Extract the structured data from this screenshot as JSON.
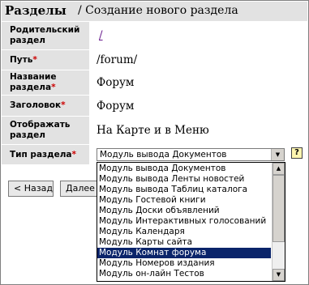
{
  "header": {
    "title_main": "Разделы",
    "title_sub": "/ Создание нового раздела"
  },
  "form": {
    "parent": {
      "label": "Родительский раздел",
      "value": "/"
    },
    "path": {
      "label": "Путь",
      "required_mark": "*",
      "value": "/forum/"
    },
    "name": {
      "label": "Название раздела",
      "required_mark": "*",
      "value": "Форум"
    },
    "heading": {
      "label": "Заголовок",
      "required_mark": "*",
      "value": "Форум"
    },
    "display": {
      "label": "Отображать раздел",
      "value": "На Карте и в Меню"
    },
    "type": {
      "label": "Тип раздела",
      "required_mark": "*",
      "selected": "Модуль вывода Документов",
      "help_icon": "question-icon",
      "help_glyph": "?",
      "arrow_glyph": "▼",
      "options": [
        "Модуль вывода Документов",
        "Модуль вывода Ленты новостей",
        "Модуль вывода Таблиц каталога",
        "Модуль Гостевой книги",
        "Модуль Доски объявлений",
        "Модуль Интерактивных голосований",
        "Модуль Календаря",
        "Модуль Карты сайта",
        "Модуль Комнат форума",
        "Модуль Номеров издания",
        "Модуль он-лайн Тестов"
      ],
      "highlighted_index": 8
    }
  },
  "buttons": {
    "back": "< Назад",
    "next": "Далее"
  },
  "scrollbar": {
    "up_glyph": "▲",
    "down_glyph": "▼"
  },
  "colors": {
    "label_bg": "#e2e2e2",
    "required": "#cc0000",
    "link": "#6a1d8e",
    "selection": "#0a246a"
  }
}
